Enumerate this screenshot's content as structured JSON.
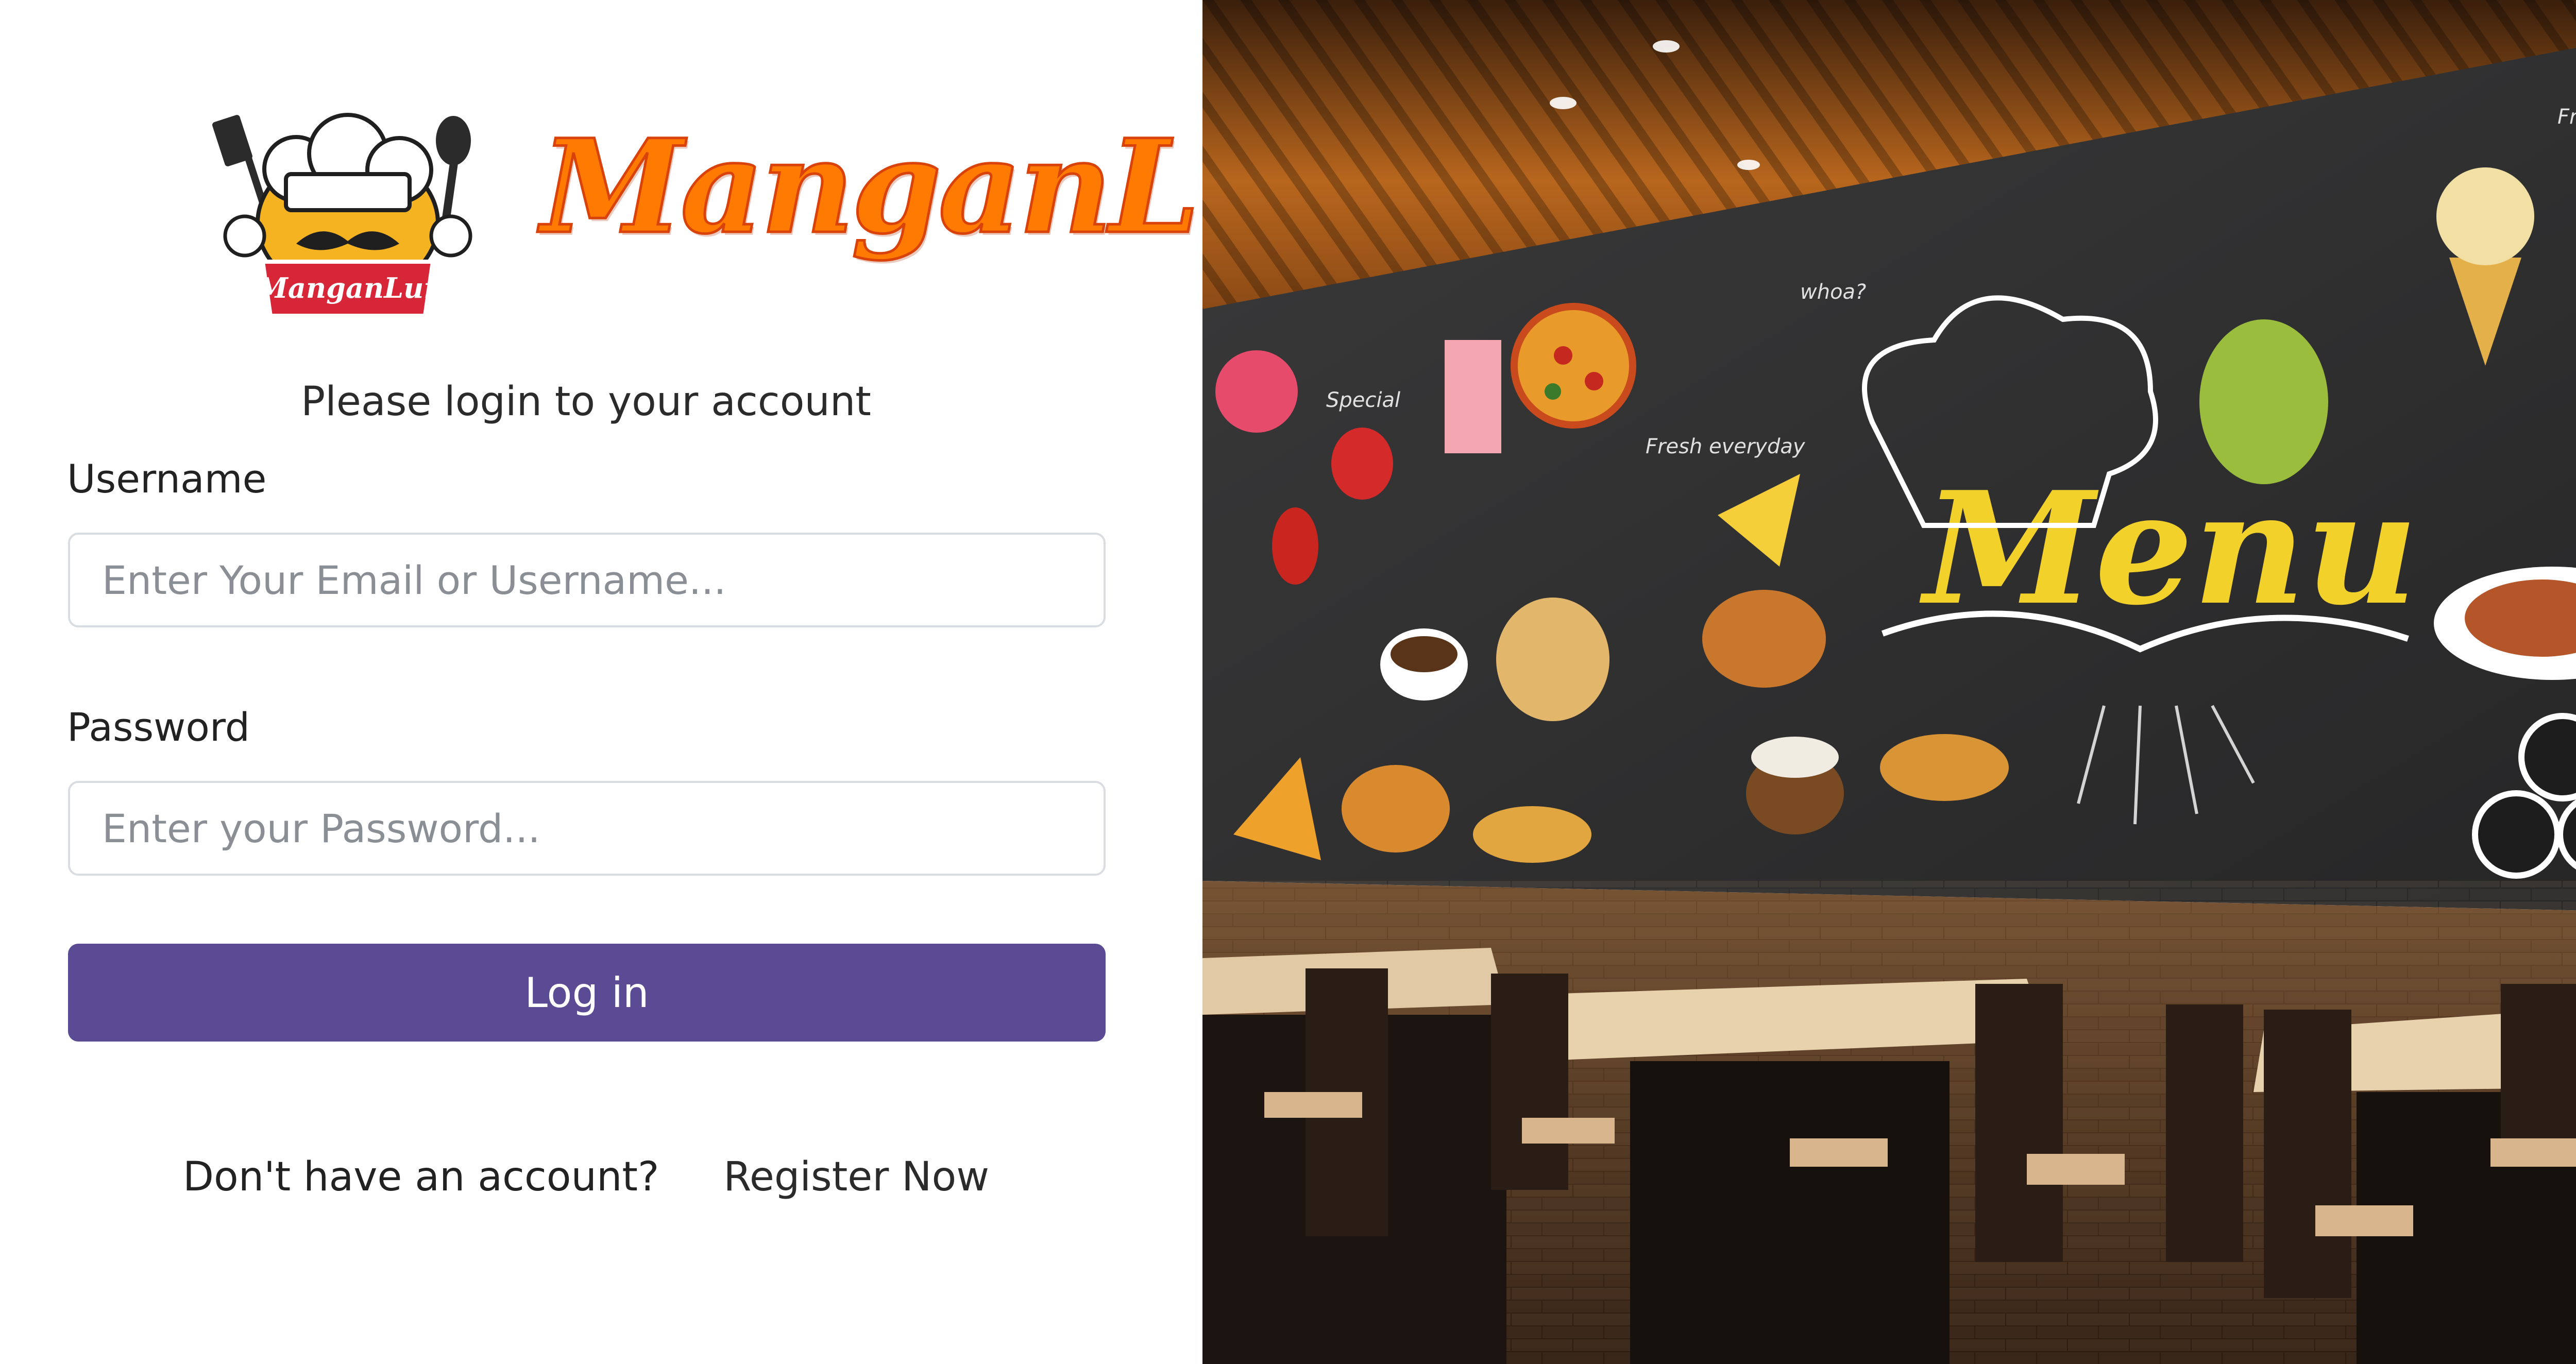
{
  "brand": {
    "name": "ManganLur",
    "badge": "ManganLur"
  },
  "login": {
    "subtitle": "Please login to your account",
    "username_label": "Username",
    "username_placeholder": "Enter Your Email or Username...",
    "password_label": "Password",
    "password_placeholder": "Enter your Password...",
    "submit_label": "Log in",
    "register_prompt": "Don't have an account?",
    "register_link": "Register Now"
  },
  "hero": {
    "menu_title": "Menu",
    "chalk_notes": [
      "Special",
      "Fresh everyday",
      "whoa?",
      "Fresh"
    ]
  },
  "colors": {
    "primary_button": "#5a4b94",
    "brand_orange": "#ff7a00",
    "chalkboard": "#2f2f30",
    "menu_yellow": "#f3d12b"
  }
}
